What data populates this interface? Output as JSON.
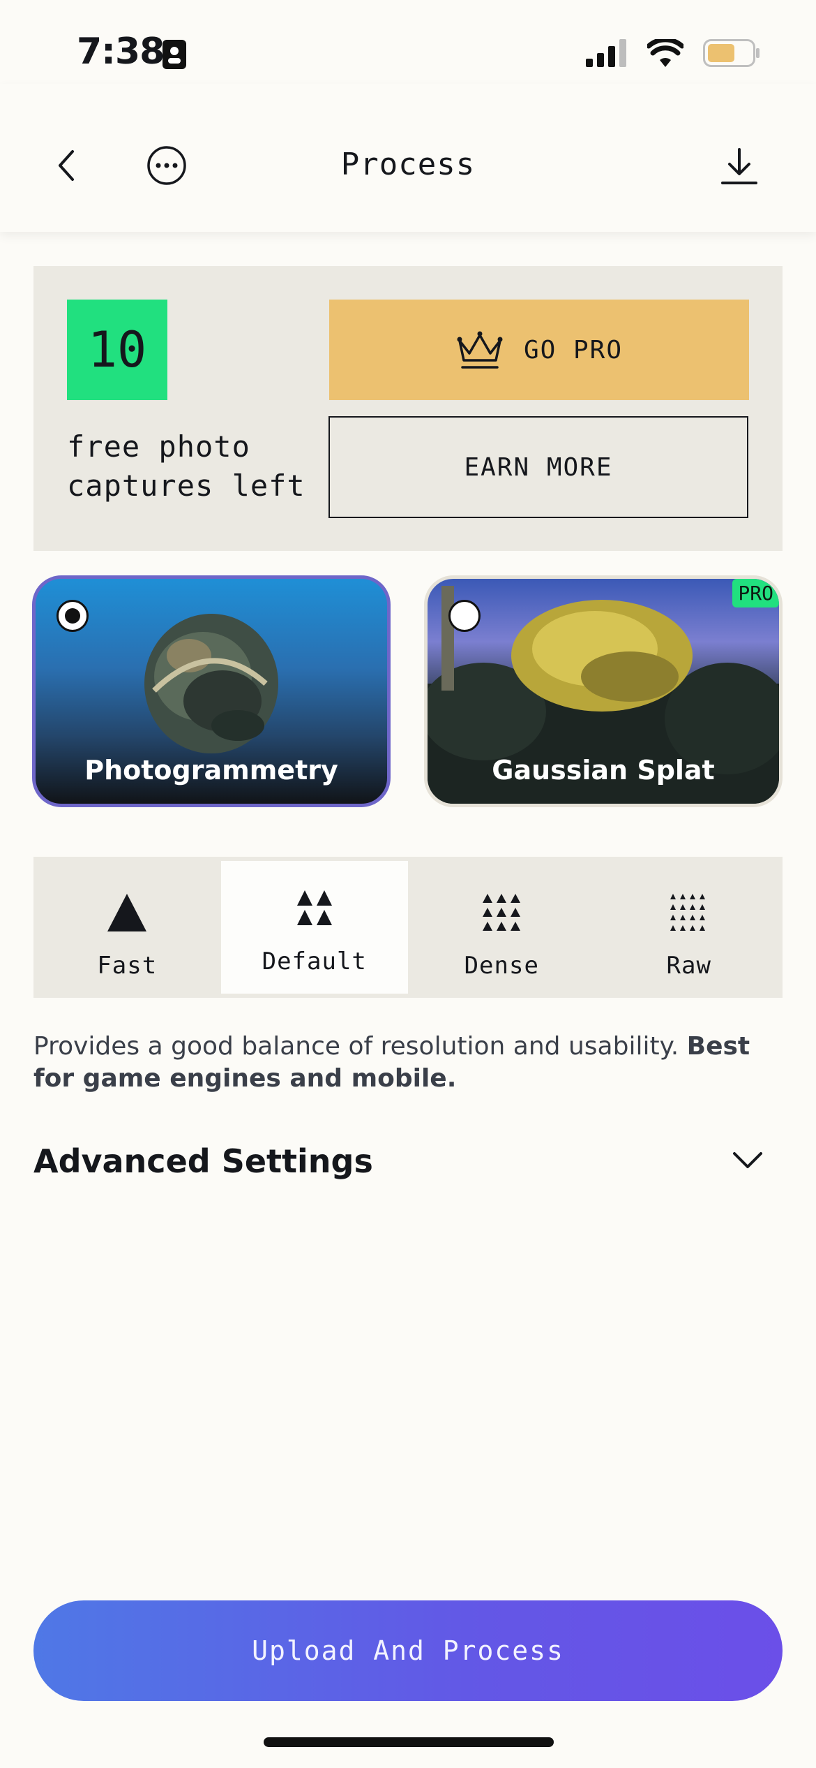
{
  "status_bar": {
    "time": "7:38"
  },
  "header": {
    "title": "Process"
  },
  "promo": {
    "count": "10",
    "free_text": "free photo captures left",
    "go_pro_label": "GO PRO",
    "earn_more_label": "EARN MORE"
  },
  "modes": [
    {
      "label": "Photogrammetry",
      "selected": true
    },
    {
      "label": "Gaussian Splat",
      "selected": false,
      "badge": "PRO"
    }
  ],
  "quality_options": [
    {
      "label": "Fast"
    },
    {
      "label": "Default",
      "selected": true
    },
    {
      "label": "Dense"
    },
    {
      "label": "Raw"
    }
  ],
  "description": {
    "text": "Provides a good balance of resolution and usability. ",
    "bold": "Best for game engines and mobile."
  },
  "advanced_settings": {
    "label": "Advanced Settings"
  },
  "upload_button": {
    "label": "Upload And Process"
  },
  "colors": {
    "accent_green": "#21e07f",
    "go_pro_yellow": "#ecc170",
    "selected_border": "#6e66c9",
    "upload_gradient_start": "#4f78e6",
    "upload_gradient_end": "#6b4fe8"
  }
}
